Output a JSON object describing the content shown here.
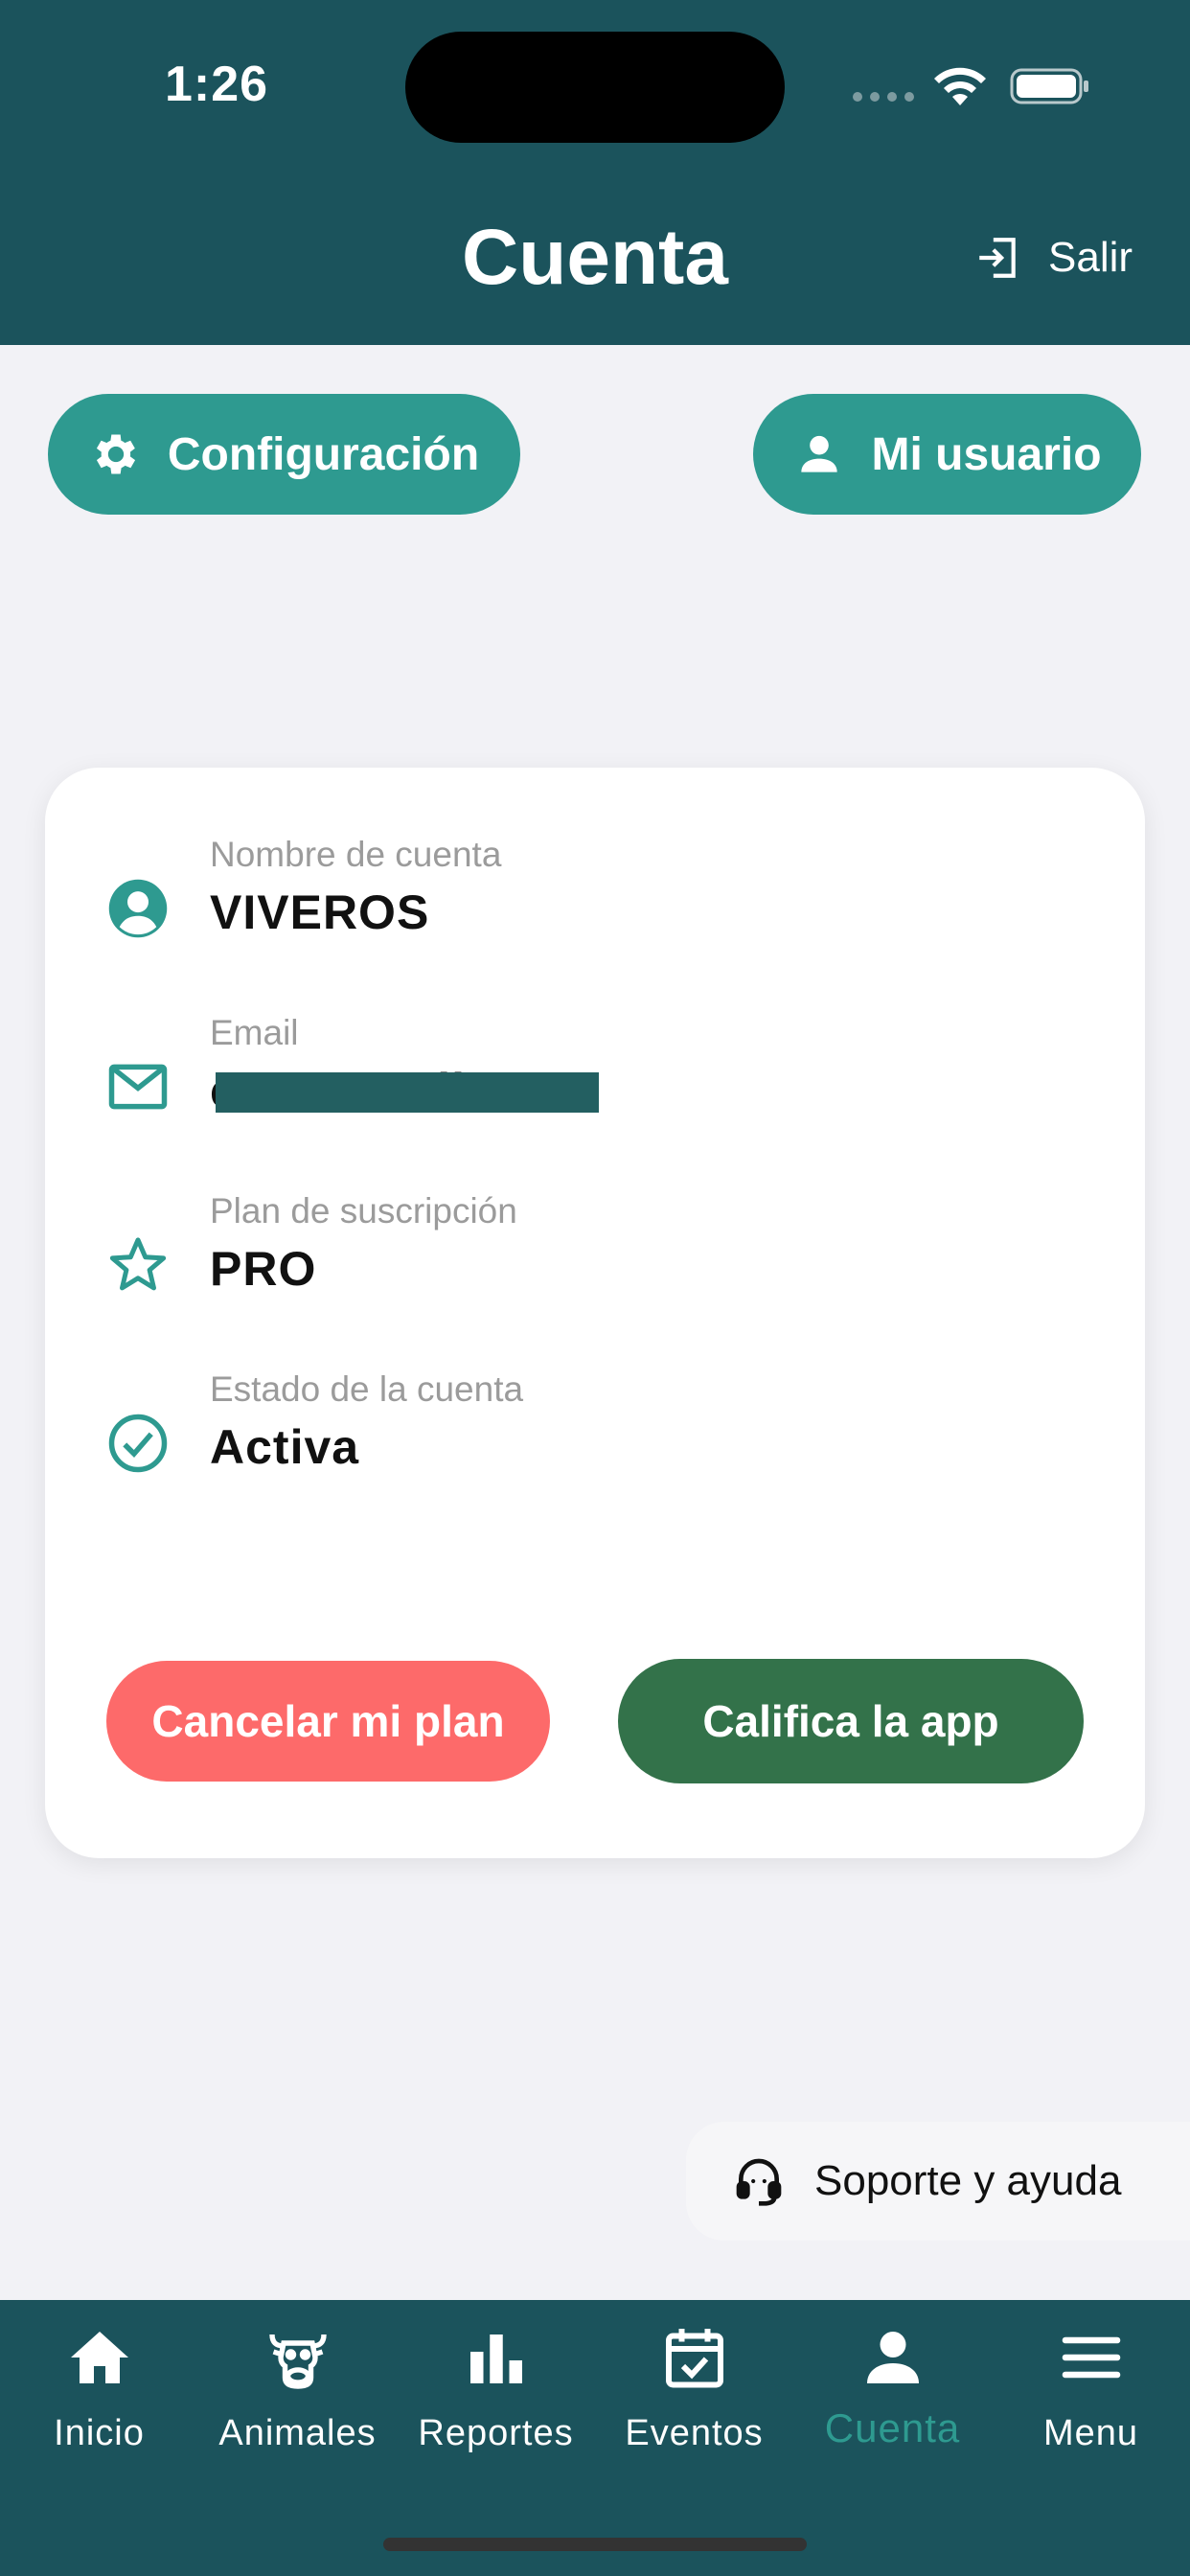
{
  "status_bar": {
    "time": "1:26"
  },
  "header": {
    "title": "Cuenta",
    "logout_label": "Salir"
  },
  "actions": {
    "config_label": "Configuración",
    "user_label": "Mi usuario"
  },
  "account": {
    "name_label": "Nombre de cuenta",
    "name_value": "VIVEROS",
    "email_label": "Email",
    "email_value": "c              il.com",
    "plan_label": "Plan de suscripción",
    "plan_value": "PRO",
    "status_label": "Estado de la cuenta",
    "status_value": "Activa"
  },
  "card_buttons": {
    "cancel_label": "Cancelar mi plan",
    "rate_label": "Califica la app"
  },
  "support": {
    "label": "Soporte y ayuda"
  },
  "nav": {
    "items": [
      {
        "label": "Inicio",
        "icon": "home-icon"
      },
      {
        "label": "Animales",
        "icon": "cow-icon"
      },
      {
        "label": "Reportes",
        "icon": "bar-chart-icon"
      },
      {
        "label": "Eventos",
        "icon": "calendar-check-icon"
      },
      {
        "label": "Cuenta",
        "icon": "person-icon"
      },
      {
        "label": "Menu",
        "icon": "menu-icon"
      }
    ],
    "active": "Cuenta"
  },
  "colors": {
    "header": "#1b535c",
    "accent": "#2e9a90",
    "cancel": "#fd6a6a",
    "rate": "#33724a"
  }
}
